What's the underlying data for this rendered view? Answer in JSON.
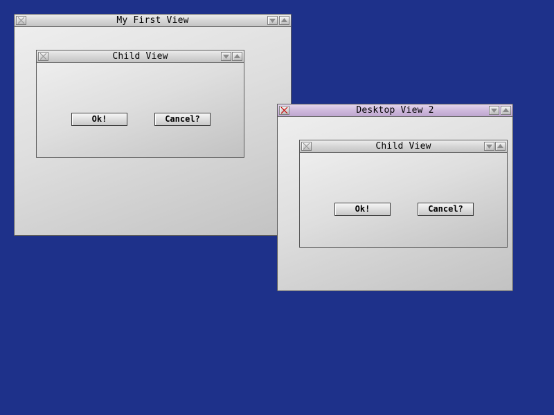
{
  "desktop": {
    "background": "#1e318a"
  },
  "windows": [
    {
      "title": "My First View",
      "active": false,
      "child": {
        "title": "Child View",
        "ok_label": "Ok!",
        "cancel_label": "Cancel?"
      }
    },
    {
      "title": "Desktop View 2",
      "active": true,
      "child": {
        "title": "Child View",
        "ok_label": "Ok!",
        "cancel_label": "Cancel?"
      }
    }
  ],
  "colors": {
    "active_titlebar": "#cdb7db",
    "inactive_titlebar": "#d4d4d4",
    "close_x_active": "#c80000",
    "close_x_inactive": "#909090"
  },
  "icons": {
    "close": "close-x-icon",
    "minimize": "triangle-down-icon",
    "maximize": "triangle-up-icon"
  }
}
